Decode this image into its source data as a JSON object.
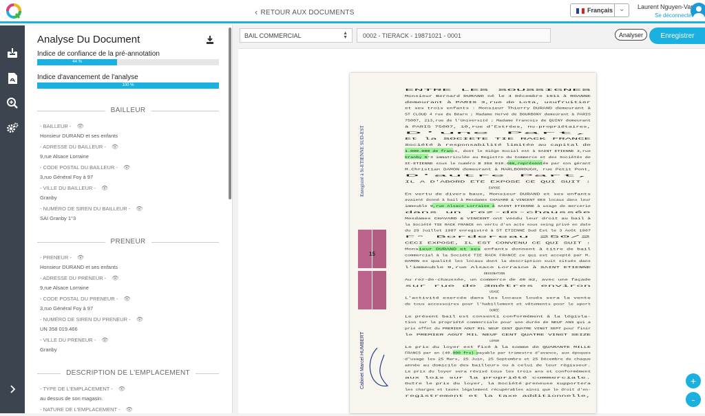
{
  "header": {
    "back_label": "RETOUR AUX DOCUMENTS",
    "language": "Français",
    "user_name": "Laurent Nguyen-Van",
    "logout_label": "Se déconnecter"
  },
  "colors": {
    "accent": "#1ab0e0",
    "rail": "#3c4450",
    "highlight": "#7df27d"
  },
  "panel": {
    "title": "Analyse Du Document",
    "confidence_label": "Indice de confiance de la pré-annotation",
    "confidence_value": "44 %",
    "confidence_fraction": 0.44,
    "progress_label": "Indice d'avancement de l'analyse",
    "progress_value": "100 %",
    "progress_fraction": 1.0,
    "sections": [
      {
        "title": "BAILLEUR",
        "fields": [
          {
            "label": "- BAILLEUR -",
            "value": "Honsieur DURAND et ses enfants"
          },
          {
            "label": "- ADRESSE DU BAILLEUR -",
            "value": "9,rue Alsace Lorraine"
          },
          {
            "label": "- CODE POSTAL DU BAILLEUR -",
            "value": "3,ruo Général Foy à 97"
          },
          {
            "label": "- VILLE DU BAILLEUR -",
            "value": "Granby"
          },
          {
            "label": "- NUMÉRO DE SIREN DU BAILLEUR -",
            "value": "SAI Granby 1°3"
          }
        ]
      },
      {
        "title": "PRENEUR",
        "fields": [
          {
            "label": "- PRENEUR -",
            "value": "Honsieur DURAND et ses enfants"
          },
          {
            "label": "- ADRESSE DU PRENEUR -",
            "value": "9,rue Alsace Lorraine"
          },
          {
            "label": "- CODE POSTAL DU PRENEUR -",
            "value": "3,ruo Général Foy à 97"
          },
          {
            "label": "- NUMÉRO DE SIREN DU PRENEUR -",
            "value": "UN 358 019.466"
          },
          {
            "label": "- VILLE DU PRENEUR -",
            "value": "Granby"
          }
        ]
      },
      {
        "title": "DESCRIPTION DE L'EMPLACEMENT",
        "fields": [
          {
            "label": "- TYPE DE L'EMPLACEMENT -",
            "value": "au dessus de son magasin."
          },
          {
            "label": "- NATURE DE L'EMPLACEMENT -",
            "value": ""
          }
        ]
      }
    ]
  },
  "toolbar": {
    "doc_type": "BAIL COMMERCIAL",
    "doc_ref": "0002 - TIERACK - 19871021 - 0001",
    "analyze_label": "Analyser",
    "save_label": "Enregistrer"
  },
  "zoom": {
    "in_label": "+",
    "out_label": "-"
  },
  "document": {
    "lines": [
      "ENTRE LES SOUSSIGNES",
      "Monsieur Bernard DURAND né le 4 Décembre 1911 à ROANNE",
      "demeurant à PARIS 3,rue de Lota, usufruitier",
      "et ses trois enfants : Monsieur Thierry DURAND demeurant à",
      "ST CLOUD 4 rue du Béarn ; Madame Hervé de BOURBONY demeurant à PARIS",
      "75007, 213,rue de l'Université ; Madame Francois de QUINY demeurant",
      "à PARIS 75007, 10,rue d'Estrées, nu-propriétaires,",
      "D'une Part,",
      "Et la SOCIETE TIE RACK FRANCE",
      "Société à responsabilité limitée au capital de",
      "1.000.000 de francs, dont le Siège Social est à SAINT ETIENNE 3,rue",
      "Granby N°3 immatriculée au Registre du Commerce et des Sociétés de",
      "St-ETIENNE sous le numéro B 358 019.466,représentée par son gérant",
      "M.Christian DAMON demeurant à MARLBOROUGH, rue Petit Pont,",
      "D'autre Part,",
      "IL A D'ABORD ETE EXPOSE CE QUI SUIT :",
      "EXPOSE",
      "En vertu de divers baux, Monsieur DURAND et ses enfants",
      "avaient donné à bail à Mesdames CHAVARD & VINCENT DES locaux dans leur",
      "immeuble 9,rue Alsace Lorraine à SAINT ETIENNE à usage de mercerie",
      "dans un rez-de-chaussée",
      "Mesdames CHAVARD & VINCENT ont vendu leur droit au bail à",
      "la Société TIE RACK FRANCE en vertu d'un acte sous seing privé en date",
      "du 29 Juillet 1987 enregistré à ST ETIENNE Sud Est le 3 Août 1987",
      "F° Bordereau 250/2",
      "CECI EXPOSE, IL EST CONVENU CE QUI SUIT :",
      "Monsieur DURAND et ses enfants donnent à titre de bail",
      "commercial à la Société TIE RACK FRANCE ce qui est accepté par M.",
      "DAMON es qualité les locaux dont la description suit situés dans",
      "l'immeuble 9,rue Alsace Lorraine à SAINT ETIENNE",
      "DESIGNATION",
      "Au rez-de-chaussée, un commerce de 40 m2, avec une façade",
      "sur rue de 3mètres environ",
      "USAGE",
      "L'activité exercée dans les locaux loués sera la vente",
      "de tous accessoires pour l'habillement et vêtements pour le sport",
      "DUREE",
      "Le présent bail est consenti conformément à la législa-",
      "tion sur la propriété commerciale pour une durée de NEUF ANS qui a",
      "pris effet du PREMIER AOUT MIL NEUF CENT QUATRE VINGT SEPT pour finir",
      "le PREMIER AOUT MIL NEUF CENT QUATRE VINGT SEIZE",
      "LOYER",
      "Le prix du loyer est fixé à la somme de QUARANTE MILLE",
      "FRANCS par an (40.000 frs) payable par trimestre d'avance, aux époques",
      "d'usage les 25 Mars, 25 Juin, 25 Septembre et 25 Décembre de chaque",
      "année au domicile des bailleurs ou à celui de leur régisseur.",
      "Le prix du loyer sera révisé tous les trois ans et conformément",
      "aux lois sur la propriété commerciale.",
      "Outre le prix du loyer, la Société preneuse supportera",
      "les charges et taxes légalement récupérables ainsi que le droit d'en-",
      "registrement et la taxe additionnelle,"
    ],
    "stamp_number": "15",
    "margin_stamp": "Enregistré à St-ETIENNE SUD-EST",
    "side_stamp": "Cabinet Marcel HUMBERT"
  }
}
